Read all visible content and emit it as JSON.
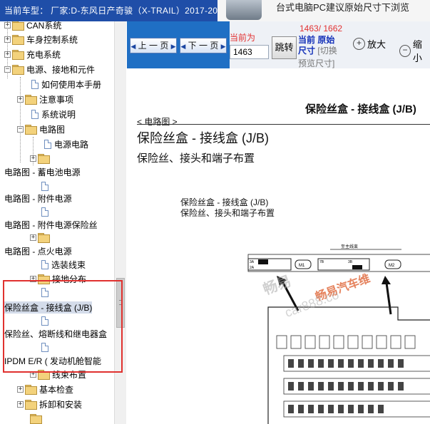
{
  "header": {
    "car_label": "当前车型： 厂家:D-东风日产奇骏（X-TRAIL）2017-2018"
  },
  "banner": {
    "text": "台式电脑PC建议原始尺寸下浏览"
  },
  "tree": {
    "items": [
      {
        "label": "CAN系统",
        "expander": "+"
      },
      {
        "label": "车身控制系统",
        "expander": "+"
      },
      {
        "label": "充电系统",
        "expander": "+"
      },
      {
        "label": "电源、接地和元件",
        "expander": "−"
      },
      {
        "label": "如何使用本手册"
      },
      {
        "label": "注意事项",
        "expander": "+"
      },
      {
        "label": "系统说明"
      },
      {
        "label": "电路图",
        "expander": "−"
      },
      {
        "label": "电源电路"
      },
      {
        "label": ""
      },
      {
        "label": "电路图 - 蓄电池电源"
      },
      {
        "label": "电路图 - 附件电源"
      },
      {
        "label": "电路图 - 附件电源保险丝"
      },
      {
        "label": ""
      },
      {
        "label": "电路图 - 点火电源"
      },
      {
        "label": "选装线束"
      },
      {
        "label": "接地分布"
      },
      {
        "label": "保险丝盒 - 接线盒 (J/B)"
      },
      {
        "label": "保险丝、熔断线和继电器盒"
      },
      {
        "label": "IPDM E/R ( 发动机舱智能"
      },
      {
        "label": "线束布置"
      },
      {
        "label": "基本检查",
        "expander": "+"
      },
      {
        "label": "拆卸和安装",
        "expander": "+"
      }
    ]
  },
  "toolbar": {
    "prev_label": "上 一 页",
    "next_label": "下 一 页",
    "current_label": "当前为",
    "current_value": "1463",
    "jump_label": "跳转",
    "page_count": "1463/ 1662",
    "size_current": "当前",
    "size_mode": "原始",
    "size_unit": "尺寸",
    "size_switch": "[切换",
    "preview_size": "预览尺寸]",
    "zoom_in_label": "放大",
    "zoom_out_label": "缩小"
  },
  "document": {
    "header_title": "保险丝盒 - 接线盒 (J/B)",
    "breadcrumb": "< 电路图 >",
    "title": "保险丝盒 - 接线盒 (J/B)",
    "subtitle": "保险丝、接头和端子布置",
    "small_title": "保险丝盒 - 接线盒 (J/B)",
    "small_subtitle": "保险丝、接头和端子布置",
    "diagram_caption": "至主线束",
    "connector_labels": [
      "3A",
      "2A",
      "1A",
      "M1",
      "7B",
      "6B",
      "5B",
      "4B",
      "3B",
      "2B",
      "1B",
      "M2"
    ],
    "watermarks": [
      "畅易",
      "畅易汽车维",
      "car888.co"
    ]
  },
  "colors": {
    "header_bg": "#1f4ea8",
    "viewer_blue": "#1f6fc4",
    "page_red": "#e23131",
    "size_blue": "#1330b8",
    "highlight_red": "#e0312f"
  }
}
